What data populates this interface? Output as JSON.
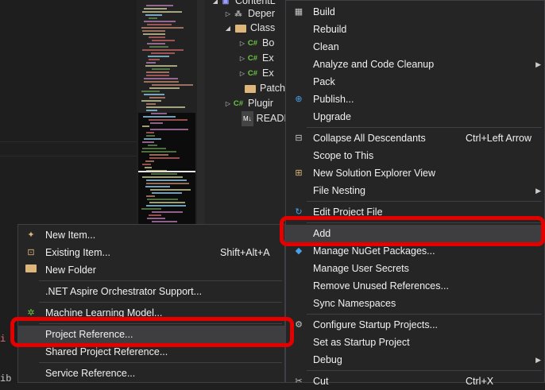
{
  "solution_explorer": {
    "items": [
      {
        "label": "ContentL",
        "icon": "project-icon"
      },
      {
        "label": "Deper",
        "icon": "dependencies-icon"
      },
      {
        "label": "Class",
        "icon": "folder-icon"
      },
      {
        "label": "Bo",
        "icon": "csharp-file-icon"
      },
      {
        "label": "Ex",
        "icon": "csharp-file-icon"
      },
      {
        "label": "Ex",
        "icon": "csharp-file-icon"
      },
      {
        "label": "Patche",
        "icon": "folder-icon"
      },
      {
        "label": "Plugir",
        "icon": "csharp-file-icon"
      },
      {
        "label": "READI",
        "icon": "markdown-file-icon"
      }
    ],
    "csharp_badge": "C#",
    "md_badge": "M↓"
  },
  "editor": {
    "fragment_1": "i",
    "fragment_2": "ib"
  },
  "context_menu": {
    "build": "Build",
    "rebuild": "Rebuild",
    "clean": "Clean",
    "analyze": "Analyze and Code Cleanup",
    "pack": "Pack",
    "publish": "Publish...",
    "upgrade": "Upgrade",
    "collapse": "Collapse All Descendants",
    "collapse_shortcut": "Ctrl+Left Arrow",
    "scope": "Scope to This",
    "new_view": "New Solution Explorer View",
    "nesting": "File Nesting",
    "edit_project": "Edit Project File",
    "add": "Add",
    "nuget": "Manage NuGet Packages...",
    "secrets": "Manage User Secrets",
    "remove_refs": "Remove Unused References...",
    "sync_ns": "Sync Namespaces",
    "startup_projects": "Configure Startup Projects...",
    "set_startup": "Set as Startup Project",
    "debug": "Debug",
    "cut": "Cut",
    "cut_shortcut": "Ctrl+X"
  },
  "add_submenu": {
    "new_item": "New Item...",
    "existing_item": "Existing Item...",
    "existing_shortcut": "Shift+Alt+A",
    "new_folder": "New Folder",
    "aspire": ".NET Aspire Orchestrator Support...",
    "ml_model": "Machine Learning Model...",
    "project_ref": "Project Reference...",
    "shared_ref": "Shared Project Reference...",
    "service_ref": "Service Reference..."
  },
  "colors": {
    "highlight_outline": "#e50000",
    "menu_background": "#252526",
    "csharp_icon": "#6cc644"
  }
}
